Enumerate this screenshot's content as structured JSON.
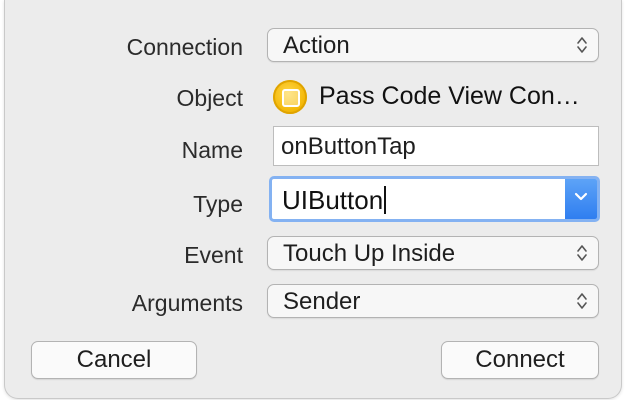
{
  "connection": {
    "label": "Connection",
    "value": "Action"
  },
  "object": {
    "label": "Object",
    "value": "Pass Code View Con…",
    "icon": "view-controller-icon",
    "icon_color": "#f2b400"
  },
  "name": {
    "label": "Name",
    "value": "onButtonTap"
  },
  "type": {
    "label": "Type",
    "value": "UIButton",
    "accent": "#2f7ef0"
  },
  "event": {
    "label": "Event",
    "value": "Touch Up Inside"
  },
  "arguments": {
    "label": "Arguments",
    "value": "Sender"
  },
  "buttons": {
    "cancel": "Cancel",
    "connect": "Connect"
  }
}
